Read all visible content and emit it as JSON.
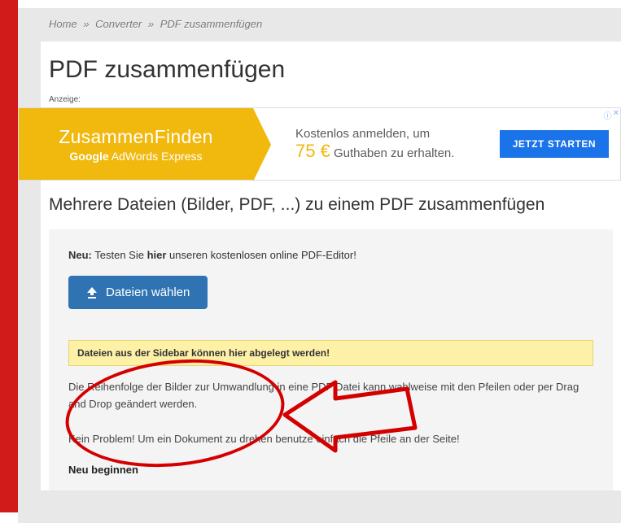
{
  "breadcrumb": {
    "home": "Home",
    "sep": "»",
    "l2": "Converter",
    "l3": "PDF zusammenfügen"
  },
  "page_title": "PDF zusammenfügen",
  "anzeige_label": "Anzeige:",
  "ad": {
    "brand_line1": "ZusammenFinden",
    "brand_line2_prefix": "Google",
    "brand_line2_rest": " AdWords Express",
    "mid_line1": "Kostenlos anmelden, um",
    "amount": "75 €",
    "mid_line2_rest": " Guthaben zu erhalten.",
    "cta": "JETZT STARTEN",
    "info": "ⓘ",
    "close": "✕"
  },
  "section_title": "Mehrere Dateien (Bilder, PDF, ...) zu einem PDF zusammenfügen",
  "upload": {
    "neu_prefix": "Neu:",
    "neu_mid1": " Testen Sie ",
    "neu_bold": "hier",
    "neu_mid2": " unseren kostenlosen online PDF-Editor!",
    "button": "Dateien wählen",
    "drop_hint": "Dateien aus der Sidebar können hier abgelegt werden!",
    "info1": "Die Reihenfolge der Bilder zur Umwandlung in eine PDF Datei kann wahlweise mit den Pfeilen oder per Drag and Drop geändert werden.",
    "info2": "Kein Problem! Um ein Dokument zu drehen benutze einfach die Pfeile an der Seite!",
    "neu_beginnen": "Neu beginnen"
  }
}
